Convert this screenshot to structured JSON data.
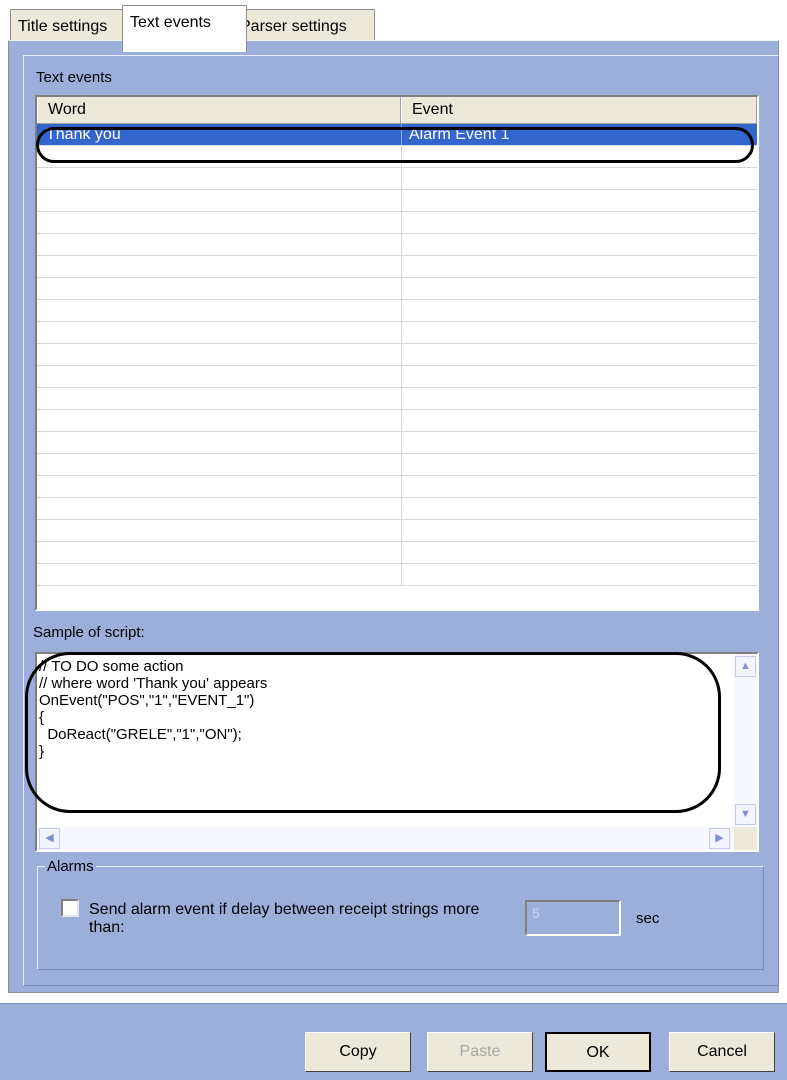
{
  "tabs": [
    {
      "label": "Title settings"
    },
    {
      "label": "Text events"
    },
    {
      "label": "Parser settings"
    }
  ],
  "active_tab": "Text events",
  "text_events": {
    "group_label": "Text events",
    "columns": [
      "Word",
      "Event"
    ],
    "rows": [
      {
        "word": "Thank you",
        "event": "Alarm Event 1",
        "selected": true
      }
    ],
    "empty_rows": 20
  },
  "script": {
    "label": "Sample of script:",
    "text": "// TO DO some action\n// where word 'Thank you' appears\nOnEvent(\"POS\",\"1\",\"EVENT_1\")\n{\n  DoReact(\"GRELE\",\"1\",\"ON\");\n}"
  },
  "alarms": {
    "legend": "Alarms",
    "checkbox_label_line1": "Send alarm event if delay between receipt strings more",
    "checkbox_label_line2": "than:",
    "checked": false,
    "delay_value": "5",
    "unit": "sec"
  },
  "buttons": {
    "copy": "Copy",
    "paste": "Paste",
    "ok": "OK",
    "cancel": "Cancel"
  },
  "colors": {
    "panel": "#9cafdb",
    "selection": "#3366cc"
  }
}
